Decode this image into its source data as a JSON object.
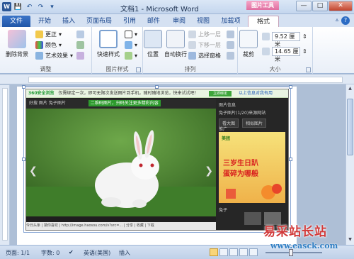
{
  "titlebar": {
    "title": "文档1 - Microsoft Word",
    "picture_tools": "图片工具",
    "word_logo": "W",
    "qat": [
      "💾",
      "↶",
      "↷",
      "▾"
    ],
    "win": [
      "—",
      "□",
      "✕"
    ]
  },
  "tabs": [
    "文件",
    "开始",
    "插入",
    "页面布局",
    "引用",
    "邮件",
    "审阅",
    "视图",
    "加载项",
    "格式"
  ],
  "active_tab": "格式",
  "ribbon": {
    "adjust": {
      "remove_bg": "删除背景",
      "corrections": "更正",
      "color": "颜色",
      "artistic": "艺术效果",
      "label": "调整"
    },
    "styles": {
      "quick_styles": "快速样式",
      "label": "图片样式"
    },
    "arrange": {
      "position": "位置",
      "wrap_text": "自动换行",
      "bring_forward": "上移一层",
      "send_backward": "下移一层",
      "selection_pane": "选择窗格",
      "label": "排列"
    },
    "size": {
      "crop": "裁剪",
      "height": "9.52 厘米",
      "width": "14.65 厘米",
      "label": "大小"
    }
  },
  "browser": {
    "notice_brand": "360安全浏览",
    "notice_text": "仅需绑定一次，即可无限次发送图片到手机，随时随地浏览，快来试试吧！",
    "notice_btn": "立即绑定",
    "notice_link": "以上信息对我有用",
    "nav_left": "好搜 图片 兔子图片",
    "nav_green": "二维码图片，扫码关注更多精彩内容",
    "side_title": "图片信息",
    "side_sub": "兔子图片(1/20)来源网站",
    "side_btn1": "看大图",
    "side_btn2": "相似图片",
    "ad_tag": "推广",
    "ad_brand": "美团",
    "ad_line1": "三岁生日趴",
    "ad_line2": "蛋碎为哪般",
    "side_bottom": "兔子",
    "bottom_text": "今日头条 | 猜你喜欢 | http://image.haosou.com/v?src=... | 分享 | 收藏 | 下载"
  },
  "status": {
    "page": "页面: 1/1",
    "words": "字数: 0",
    "lang": "英语(美国)",
    "mode": "插入"
  },
  "watermark": {
    "line1": "易采站长站",
    "line2": "www.easck.com"
  }
}
